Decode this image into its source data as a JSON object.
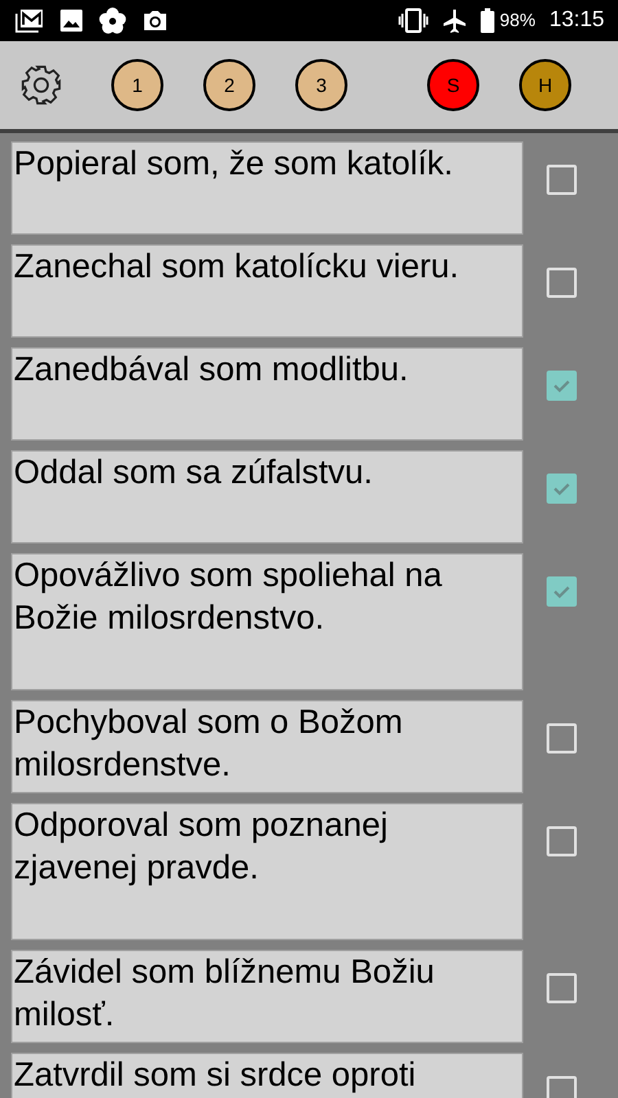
{
  "status_bar": {
    "battery": "98%",
    "time": "13:15"
  },
  "toolbar": {
    "buttons": [
      {
        "label": "1",
        "color": "#deb887"
      },
      {
        "label": "2",
        "color": "#deb887"
      },
      {
        "label": "3",
        "color": "#deb887"
      },
      {
        "label": "S",
        "color": "#ff0000"
      },
      {
        "label": "H",
        "color": "#b8860b"
      }
    ]
  },
  "items": [
    {
      "text": "Popieral som, že som katolík.",
      "checked": false
    },
    {
      "text": "Zanechal som katolícku vieru.",
      "checked": false
    },
    {
      "text": "Zanedbával som modlitbu.",
      "checked": true
    },
    {
      "text": "Oddal som sa zúfalstvu.",
      "checked": true
    },
    {
      "text": "Opovážlivo som spoliehal na Božie milosrdenstvo.",
      "checked": true
    },
    {
      "text": "Pochyboval som o Božom milosrdenstve.",
      "checked": false
    },
    {
      "text": "Odporoval som poznanej zjavenej pravde.",
      "checked": false
    },
    {
      "text": "Závidel som blížnemu Božiu milosť.",
      "checked": false
    },
    {
      "text": "Zatvrdil som si srdce oproti",
      "checked": false
    }
  ]
}
